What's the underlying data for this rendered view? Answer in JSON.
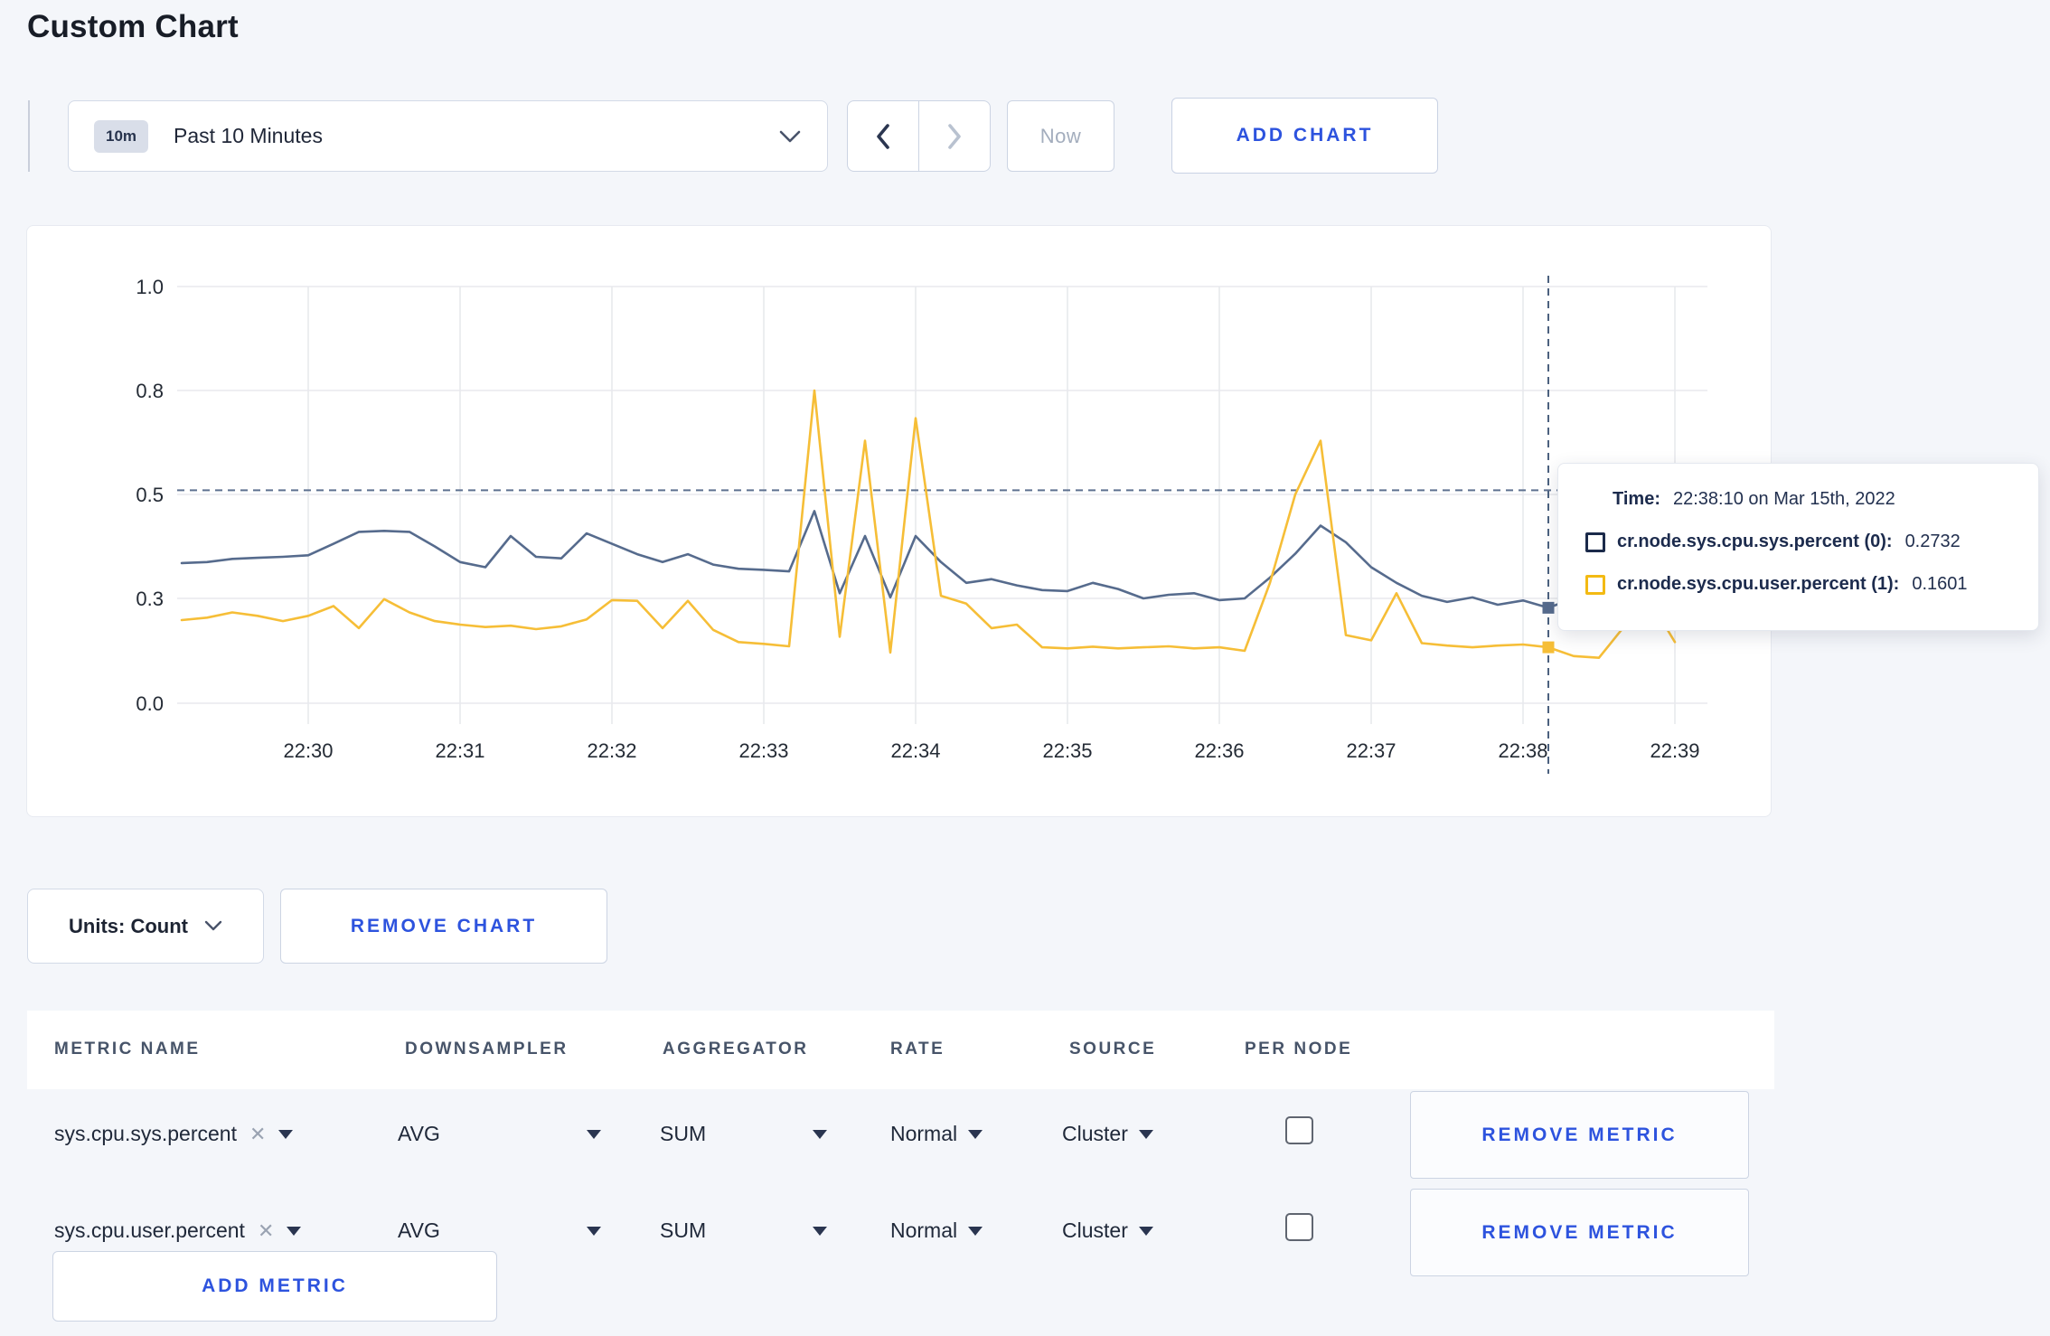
{
  "page": {
    "title": "Custom Chart"
  },
  "toolbar": {
    "time_badge": "10m",
    "time_label": "Past 10 Minutes",
    "prev_icon": "chevron-left",
    "next_icon": "chevron-right",
    "now_label": "Now",
    "add_chart_label": "ADD CHART"
  },
  "chart_footer": {
    "units_label": "Units: Count",
    "remove_chart_label": "REMOVE CHART"
  },
  "tooltip": {
    "time_label": "Time:",
    "time_value": "22:38:10 on Mar 15th, 2022",
    "entries": [
      {
        "label": "cr.node.sys.cpu.sys.percent (0):",
        "value": "0.2732",
        "swatch": "#1b2a4a"
      },
      {
        "label": "cr.node.sys.cpu.user.percent (1):",
        "value": "0.1601",
        "swatch": "#f3ba13"
      }
    ]
  },
  "chart_data": {
    "type": "line",
    "title": "",
    "xlabel": "",
    "ylabel": "",
    "ylim": [
      0,
      1
    ],
    "grid": true,
    "legend_position": "tooltip",
    "x_axis": {
      "ticks": [
        "22:30",
        "22:31",
        "22:32",
        "22:33",
        "22:34",
        "22:35",
        "22:36",
        "22:37",
        "22:38",
        "22:39"
      ]
    },
    "y_axis": {
      "ticks": [
        0,
        0.3,
        0.5,
        0.8,
        1.0
      ],
      "tick_labels": [
        "0.0",
        "0.3",
        "0.5",
        "0.8",
        "1.0"
      ],
      "note": "equal pixel spacing between ticks (non-linear)"
    },
    "crosshair": {
      "time": "22:38:10",
      "hline_value": 0.512,
      "sys_value": 0.2732,
      "user_value": 0.1601
    },
    "series": [
      {
        "name": "cr.node.sys.cpu.sys.percent (0)",
        "color": "#566b8d",
        "points": [
          [
            "22:29:10",
            0.368
          ],
          [
            "22:29:20",
            0.37
          ],
          [
            "22:29:30",
            0.376
          ],
          [
            "22:29:40",
            0.378
          ],
          [
            "22:29:50",
            0.38
          ],
          [
            "22:30:00",
            0.383
          ],
          [
            "22:30:10",
            0.405
          ],
          [
            "22:30:20",
            0.428
          ],
          [
            "22:30:30",
            0.43
          ],
          [
            "22:30:40",
            0.428
          ],
          [
            "22:30:50",
            0.4
          ],
          [
            "22:31:00",
            0.37
          ],
          [
            "22:31:10",
            0.36
          ],
          [
            "22:31:20",
            0.42
          ],
          [
            "22:31:30",
            0.38
          ],
          [
            "22:31:40",
            0.377
          ],
          [
            "22:31:50",
            0.425
          ],
          [
            "22:32:00",
            0.405
          ],
          [
            "22:32:10",
            0.385
          ],
          [
            "22:32:20",
            0.37
          ],
          [
            "22:32:30",
            0.385
          ],
          [
            "22:32:40",
            0.365
          ],
          [
            "22:32:50",
            0.357
          ],
          [
            "22:33:00",
            0.355
          ],
          [
            "22:33:10",
            0.352
          ],
          [
            "22:33:20",
            0.468
          ],
          [
            "22:33:30",
            0.31
          ],
          [
            "22:33:40",
            0.42
          ],
          [
            "22:33:50",
            0.302
          ],
          [
            "22:34:00",
            0.42
          ],
          [
            "22:34:10",
            0.37
          ],
          [
            "22:34:20",
            0.33
          ],
          [
            "22:34:30",
            0.337
          ],
          [
            "22:34:40",
            0.325
          ],
          [
            "22:34:50",
            0.316
          ],
          [
            "22:35:00",
            0.314
          ],
          [
            "22:35:10",
            0.33
          ],
          [
            "22:35:20",
            0.318
          ],
          [
            "22:35:30",
            0.3
          ],
          [
            "22:35:40",
            0.307
          ],
          [
            "22:35:50",
            0.31
          ],
          [
            "22:36:00",
            0.295
          ],
          [
            "22:36:10",
            0.3
          ],
          [
            "22:36:20",
            0.34
          ],
          [
            "22:36:30",
            0.386
          ],
          [
            "22:36:40",
            0.44
          ],
          [
            "22:36:50",
            0.408
          ],
          [
            "22:37:00",
            0.36
          ],
          [
            "22:37:10",
            0.33
          ],
          [
            "22:37:20",
            0.305
          ],
          [
            "22:37:30",
            0.29
          ],
          [
            "22:37:40",
            0.302
          ],
          [
            "22:37:50",
            0.282
          ],
          [
            "22:38:00",
            0.294
          ],
          [
            "22:38:10",
            0.2732
          ],
          [
            "22:38:20",
            0.3
          ],
          [
            "22:38:30",
            0.31
          ],
          [
            "22:38:40",
            0.295
          ],
          [
            "22:38:50",
            0.305
          ],
          [
            "22:39:00",
            0.3
          ]
        ]
      },
      {
        "name": "cr.node.sys.cpu.user.percent (1)",
        "color": "#f6be37",
        "points": [
          [
            "22:29:10",
            0.238
          ],
          [
            "22:29:20",
            0.245
          ],
          [
            "22:29:30",
            0.26
          ],
          [
            "22:29:40",
            0.25
          ],
          [
            "22:29:50",
            0.235
          ],
          [
            "22:30:00",
            0.25
          ],
          [
            "22:30:10",
            0.278
          ],
          [
            "22:30:20",
            0.215
          ],
          [
            "22:30:30",
            0.298
          ],
          [
            "22:30:40",
            0.26
          ],
          [
            "22:30:50",
            0.235
          ],
          [
            "22:31:00",
            0.225
          ],
          [
            "22:31:10",
            0.218
          ],
          [
            "22:31:20",
            0.222
          ],
          [
            "22:31:30",
            0.212
          ],
          [
            "22:31:40",
            0.22
          ],
          [
            "22:31:50",
            0.24
          ],
          [
            "22:32:00",
            0.295
          ],
          [
            "22:32:10",
            0.293
          ],
          [
            "22:32:20",
            0.215
          ],
          [
            "22:32:30",
            0.293
          ],
          [
            "22:32:40",
            0.21
          ],
          [
            "22:32:50",
            0.175
          ],
          [
            "22:33:00",
            0.17
          ],
          [
            "22:33:10",
            0.163
          ],
          [
            "22:33:20",
            0.8
          ],
          [
            "22:33:30",
            0.19
          ],
          [
            "22:33:40",
            0.655
          ],
          [
            "22:33:50",
            0.145
          ],
          [
            "22:34:00",
            0.72
          ],
          [
            "22:34:10",
            0.305
          ],
          [
            "22:34:20",
            0.285
          ],
          [
            "22:34:30",
            0.215
          ],
          [
            "22:34:40",
            0.225
          ],
          [
            "22:34:50",
            0.16
          ],
          [
            "22:35:00",
            0.157
          ],
          [
            "22:35:10",
            0.162
          ],
          [
            "22:35:20",
            0.157
          ],
          [
            "22:35:30",
            0.16
          ],
          [
            "22:35:40",
            0.163
          ],
          [
            "22:35:50",
            0.157
          ],
          [
            "22:36:00",
            0.16
          ],
          [
            "22:36:10",
            0.15
          ],
          [
            "22:36:20",
            0.33
          ],
          [
            "22:36:30",
            0.5
          ],
          [
            "22:36:40",
            0.655
          ],
          [
            "22:36:50",
            0.195
          ],
          [
            "22:37:00",
            0.18
          ],
          [
            "22:37:10",
            0.31
          ],
          [
            "22:37:20",
            0.172
          ],
          [
            "22:37:30",
            0.165
          ],
          [
            "22:37:40",
            0.16
          ],
          [
            "22:37:50",
            0.165
          ],
          [
            "22:38:00",
            0.168
          ],
          [
            "22:38:10",
            0.1601
          ],
          [
            "22:38:20",
            0.135
          ],
          [
            "22:38:30",
            0.13
          ],
          [
            "22:38:40",
            0.22
          ],
          [
            "22:38:50",
            0.295
          ],
          [
            "22:39:00",
            0.175
          ]
        ]
      }
    ]
  },
  "metrics_table": {
    "headers": [
      "METRIC NAME",
      "DOWNSAMPLER",
      "AGGREGATOR",
      "RATE",
      "SOURCE",
      "PER NODE"
    ],
    "rows": [
      {
        "metric": "sys.cpu.sys.percent",
        "downsampler": "AVG",
        "aggregator": "SUM",
        "rate": "Normal",
        "source": "Cluster",
        "per_node": false,
        "remove_label": "REMOVE METRIC"
      },
      {
        "metric": "sys.cpu.user.percent",
        "downsampler": "AVG",
        "aggregator": "SUM",
        "rate": "Normal",
        "source": "Cluster",
        "per_node": false,
        "remove_label": "REMOVE METRIC"
      }
    ],
    "add_metric_label": "ADD METRIC"
  }
}
